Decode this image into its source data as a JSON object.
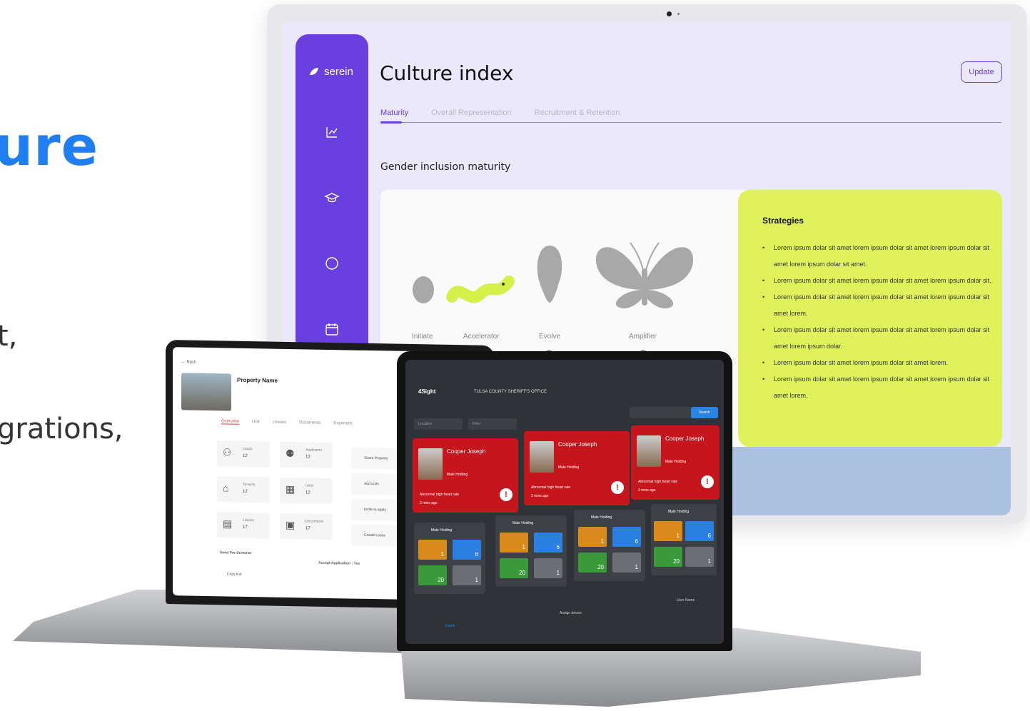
{
  "hero": {
    "headline_fragment": "ure",
    "line1_fragment": "t,",
    "line2_fragment": "grations,"
  },
  "monitor": {
    "app": {
      "logo": "serein",
      "title": "Culture index",
      "update_label": "Update",
      "tabs": [
        "Maturity",
        "Overall Representation",
        "Recruitment & Retention"
      ],
      "active_tab": "Maturity",
      "section_title": "Gender inclusion maturity",
      "stages": [
        "Initiate",
        "Accelerator",
        "Evolve",
        "Amplifier"
      ],
      "current_stage": "Accelerator",
      "strategies": {
        "title": "Strategies",
        "items": [
          "Lorem ipsum dolar sit amet lorem ipsum dolar sit amet lorem ipsum dolar sit amet lorem ipsum dolar sit amet.",
          "Lorem ipsum dolar sit amet lorem ipsum dolar sit amet lorem ipsum dolar sit.",
          "Lorem ipsum dolar sit amet lorem ipsum dolar sit amet lorem ipsum dolar sit amet lorem.",
          "Lorem ipsum dolar sit amet lorem ipsum dolar sit amet lorem ipsum dolar sit amet lorem ipsum dolar.",
          "Lorem ipsum dolar sit amet lorem ipsum dolar sit amet lorem.",
          "Lorem ipsum dolar sit amet lorem ipsum dolar sit amet lorem ipsum dolar sit amet lorem."
        ]
      },
      "colors": {
        "sidebar": "#6a3fe0",
        "strategies_bg": "#dff25c",
        "accent_worm": "#d6f04a"
      }
    }
  },
  "laptop_left": {
    "back": "← Back",
    "property_name": "Property Name",
    "tabs": [
      "Overview",
      "Unit",
      "Leases",
      "Documents",
      "Expenses"
    ],
    "active_tab": "Overview",
    "stats": [
      {
        "label": "Leads",
        "value": "12",
        "icon": "users-icon"
      },
      {
        "label": "Applicants",
        "value": "12",
        "icon": "applicants-icon"
      },
      {
        "label": "Tenants",
        "value": "12",
        "icon": "tenants-icon"
      },
      {
        "label": "Units",
        "value": "12",
        "icon": "units-icon"
      },
      {
        "label": "Leases",
        "value": "17",
        "icon": "lease-icon"
      },
      {
        "label": "Documents",
        "value": "17",
        "icon": "documents-icon"
      }
    ],
    "actions": [
      "Share Property",
      "Add units",
      "Invite to apply",
      "Create Lease"
    ],
    "pre_screener": "Send Pre-Screener",
    "copy_link": "Copy link",
    "accept_application": "Accept Application : Yes"
  },
  "laptop_right": {
    "brand": "4Sight",
    "office": "TULSA COUNTY SHERIFF'S OFFICE",
    "filters": [
      "Location",
      "Filter"
    ],
    "search_label": "Search",
    "alert_cards": [
      {
        "name": "Cooper Joseph",
        "status": "Male Holding",
        "alert": "Abnormal high heart rate",
        "time": "2 mins ago"
      },
      {
        "name": "Cooper Joseph",
        "status": "Male Holding",
        "alert": "Abnormal high heart rate",
        "time": "2 mins ago"
      },
      {
        "name": "Cooper Joseph",
        "status": "Male Holding",
        "alert": "Abnormal high heart rate",
        "time": "2 mins ago"
      }
    ],
    "holding_cards": [
      {
        "title": "Male Holding",
        "warning": "1",
        "excluding": "6",
        "ok": "20",
        "disconnected": "1"
      },
      {
        "title": "Male Holding",
        "warning": "1",
        "excluding": "6",
        "ok": "20",
        "disconnected": "1"
      },
      {
        "title": "Male Holding",
        "warning": "1",
        "excluding": "6",
        "ok": "20",
        "disconnected": "1"
      },
      {
        "title": "Male Holding",
        "warning": "1",
        "excluding": "6",
        "ok": "20",
        "disconnected": "1"
      }
    ],
    "nav": [
      "Home",
      "Assign device",
      "User Name"
    ]
  }
}
